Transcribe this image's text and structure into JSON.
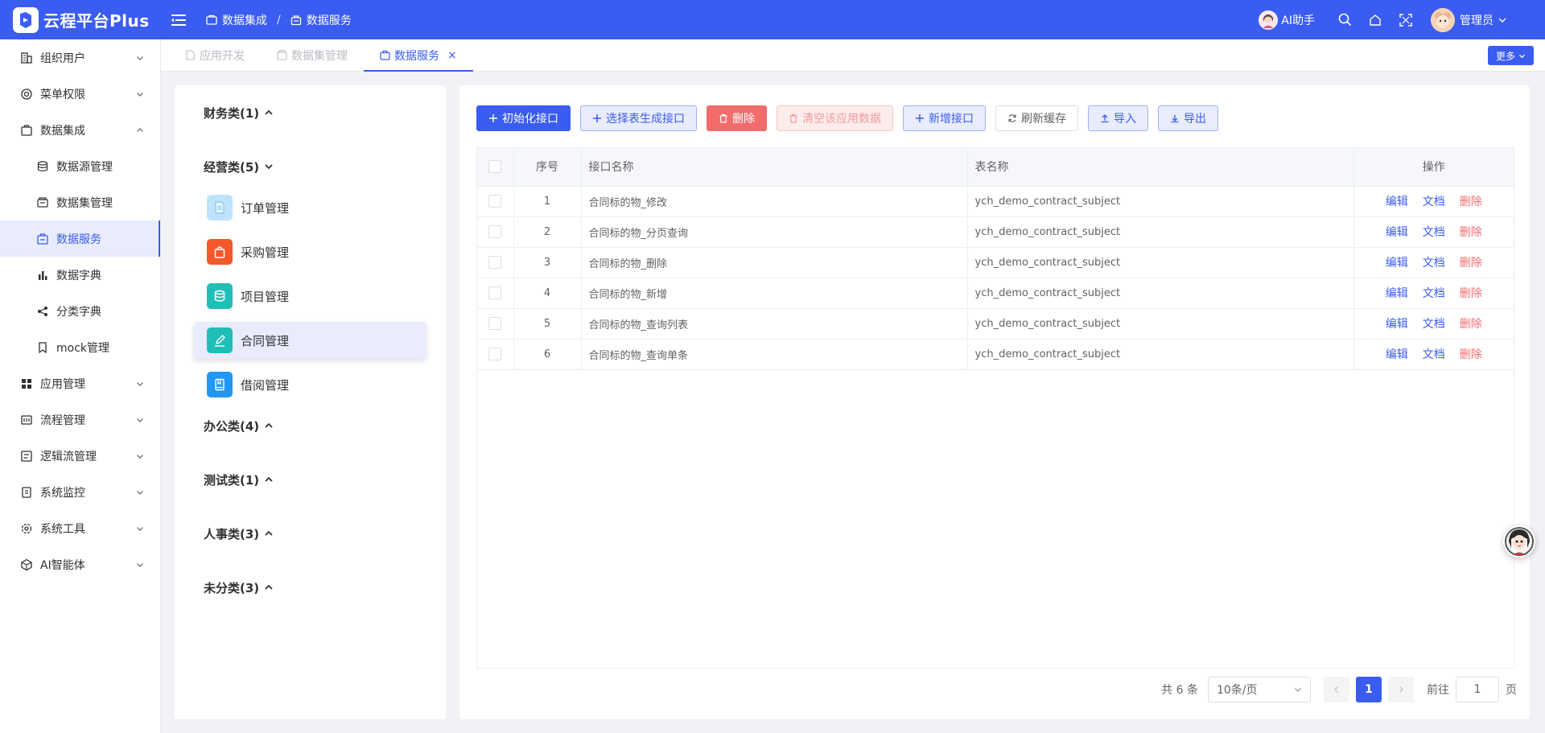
{
  "app": {
    "title": "云程平台Plus"
  },
  "breadcrumb": [
    {
      "label": "数据集成"
    },
    {
      "label": "数据服务"
    }
  ],
  "header": {
    "ai_label": "AI助手",
    "user_name": "管理员"
  },
  "sidebar": {
    "items": [
      {
        "label": "组织用户",
        "icon": "org-icon",
        "expanded": false
      },
      {
        "label": "菜单权限",
        "icon": "menu-perm-icon",
        "expanded": false
      },
      {
        "label": "数据集成",
        "icon": "data-integration-icon",
        "expanded": true
      },
      {
        "label": "数据源管理",
        "icon": "database-icon",
        "sub": true
      },
      {
        "label": "数据集管理",
        "icon": "dataset-icon",
        "sub": true
      },
      {
        "label": "数据服务",
        "icon": "data-service-icon",
        "sub": true,
        "active": true
      },
      {
        "label": "数据字典",
        "icon": "bar-chart-icon",
        "sub": true
      },
      {
        "label": "分类字典",
        "icon": "share-icon",
        "sub": true
      },
      {
        "label": "mock管理",
        "icon": "bookmark-icon",
        "sub": true
      },
      {
        "label": "应用管理",
        "icon": "grid-icon",
        "expanded": false
      },
      {
        "label": "流程管理",
        "icon": "flow-icon",
        "expanded": false
      },
      {
        "label": "逻辑流管理",
        "icon": "logic-flow-icon",
        "expanded": false
      },
      {
        "label": "系统监控",
        "icon": "monitor-icon",
        "expanded": false
      },
      {
        "label": "系统工具",
        "icon": "gear-icon",
        "expanded": false
      },
      {
        "label": "AI智能体",
        "icon": "ai-agent-icon",
        "expanded": false
      }
    ]
  },
  "tabs": [
    {
      "label": "应用开发",
      "active": false
    },
    {
      "label": "数据集管理",
      "active": false
    },
    {
      "label": "数据服务",
      "active": true,
      "closable": true
    }
  ],
  "more_label": "更多",
  "categories": [
    {
      "label": "财务类(1)",
      "open": false
    },
    {
      "label": "经营类(5)",
      "open": true,
      "items": [
        {
          "label": "订单管理",
          "color": "#bfe3fb",
          "icon": "document-icon"
        },
        {
          "label": "采购管理",
          "color": "#f5592b",
          "icon": "shopping-bag-icon"
        },
        {
          "label": "项目管理",
          "color": "#1fbfb8",
          "icon": "database-icon"
        },
        {
          "label": "合同管理",
          "color": "#1fbfb8",
          "icon": "pen-icon",
          "active": true
        },
        {
          "label": "借阅管理",
          "color": "#2196f3",
          "icon": "book-icon"
        }
      ]
    },
    {
      "label": "办公类(4)",
      "open": false
    },
    {
      "label": "测试类(1)",
      "open": false
    },
    {
      "label": "人事类(3)",
      "open": false
    },
    {
      "label": "未分类(3)",
      "open": false
    }
  ],
  "toolbar": {
    "init": "初始化接口",
    "select_table": "选择表生成接口",
    "delete": "删除",
    "clear_app_data": "清空该应用数据",
    "add_api": "新增接口",
    "refresh_cache": "刷新缓存",
    "import": "导入",
    "export": "导出"
  },
  "table": {
    "headers": {
      "index": "序号",
      "api_name": "接口名称",
      "table_name": "表名称",
      "ops": "操作"
    },
    "rows": [
      {
        "index": "1",
        "api_name": "合同标的物_修改",
        "table_name": "ych_demo_contract_subject"
      },
      {
        "index": "2",
        "api_name": "合同标的物_分页查询",
        "table_name": "ych_demo_contract_subject"
      },
      {
        "index": "3",
        "api_name": "合同标的物_删除",
        "table_name": "ych_demo_contract_subject"
      },
      {
        "index": "4",
        "api_name": "合同标的物_新增",
        "table_name": "ych_demo_contract_subject"
      },
      {
        "index": "5",
        "api_name": "合同标的物_查询列表",
        "table_name": "ych_demo_contract_subject"
      },
      {
        "index": "6",
        "api_name": "合同标的物_查询单条",
        "table_name": "ych_demo_contract_subject"
      }
    ],
    "ops": {
      "edit": "编辑",
      "doc": "文档",
      "delete": "删除"
    }
  },
  "pager": {
    "total": "共 6 条",
    "page_size": "10条/页",
    "current": "1",
    "goto_label": "前往",
    "goto_value": "1",
    "page_unit": "页"
  },
  "colors": {
    "primary": "#3a5cf0",
    "danger": "#f36c6c"
  }
}
